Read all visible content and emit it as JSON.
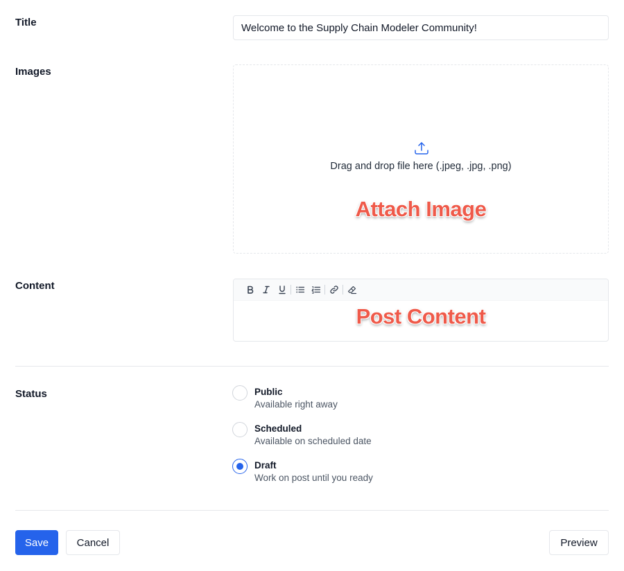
{
  "form": {
    "title": {
      "label": "Title",
      "value": "Welcome to the Supply Chain Modeler Community!"
    },
    "images": {
      "label": "Images",
      "dropzone_text": "Drag and drop file here (.jpeg, .jpg, .png)",
      "upload_icon": "upload-icon",
      "annotation": "Attach Image"
    },
    "content": {
      "label": "Content",
      "toolbar": [
        {
          "name": "bold",
          "icon": "bold-icon"
        },
        {
          "name": "italic",
          "icon": "italic-icon"
        },
        {
          "name": "underline",
          "icon": "underline-icon"
        },
        {
          "name": "bullet-list",
          "icon": "bullet-list-icon"
        },
        {
          "name": "ordered-list",
          "icon": "ordered-list-icon"
        },
        {
          "name": "link",
          "icon": "link-icon"
        },
        {
          "name": "clear-format",
          "icon": "eraser-icon"
        }
      ],
      "annotation": "Post Content"
    },
    "status": {
      "label": "Status",
      "selected": "Draft",
      "options": [
        {
          "title": "Public",
          "description": "Available right away",
          "checked": false
        },
        {
          "title": "Scheduled",
          "description": "Available on scheduled date",
          "checked": false
        },
        {
          "title": "Draft",
          "description": "Work on post until you ready",
          "checked": true
        }
      ]
    }
  },
  "actions": {
    "save": "Save",
    "cancel": "Cancel",
    "preview": "Preview"
  },
  "colors": {
    "primary": "#2563eb",
    "annotation": "#ef5a4a",
    "border": "#e5e7eb"
  }
}
